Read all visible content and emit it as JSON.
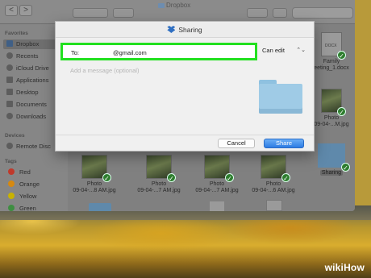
{
  "window": {
    "title": "Dropbox",
    "nav_back": "<",
    "nav_forward": ">"
  },
  "sidebar": {
    "favorites_header": "Favorites",
    "favorites": [
      {
        "label": "Dropbox",
        "icon": "dropbox-icon"
      },
      {
        "label": "Recents",
        "icon": "clock-icon"
      },
      {
        "label": "iCloud Drive",
        "icon": "cloud-icon"
      },
      {
        "label": "Applications",
        "icon": "applications-icon"
      },
      {
        "label": "Desktop",
        "icon": "desktop-icon"
      },
      {
        "label": "Documents",
        "icon": "document-icon"
      },
      {
        "label": "Downloads",
        "icon": "download-icon"
      }
    ],
    "devices_header": "Devices",
    "devices": [
      {
        "label": "Remote Disc",
        "icon": "disc-icon"
      }
    ],
    "tags_header": "Tags",
    "tags": [
      {
        "label": "Red",
        "color": "#c0392b"
      },
      {
        "label": "Orange",
        "color": "#d68910"
      },
      {
        "label": "Yellow",
        "color": "#c9b200"
      },
      {
        "label": "Green",
        "color": "#3e8e41"
      }
    ]
  },
  "files": {
    "top_right": [
      {
        "line1": "Family",
        "line2": "eeting_1.docx",
        "doc_tag": "DOCX"
      },
      {
        "line1": "Photo",
        "line2": "09-04-...M.jpg"
      },
      {
        "line1": "Sharing",
        "line2": ""
      }
    ],
    "bottom_row": [
      {
        "line1": "Photo",
        "line2": "09-04-...8 AM.jpg"
      },
      {
        "line1": "Photo",
        "line2": "09-04-...7 AM.jpg"
      },
      {
        "line1": "Photo",
        "line2": "09-04-...7 AM.jpg"
      },
      {
        "line1": "Photo",
        "line2": "09-04-...6 AM.jpg"
      }
    ]
  },
  "sharing": {
    "title": "Sharing",
    "to_label": "To:",
    "email": "@gmail.com",
    "permission": "Can edit",
    "permission_arrows": "⌃⌄",
    "message_placeholder": "Add a message (optional)",
    "cancel_label": "Cancel",
    "share_label": "Share",
    "highlight_color": "#22e01f",
    "accent_color": "#2d7be3"
  },
  "watermark": {
    "wiki": "wiki",
    "how": "How"
  }
}
